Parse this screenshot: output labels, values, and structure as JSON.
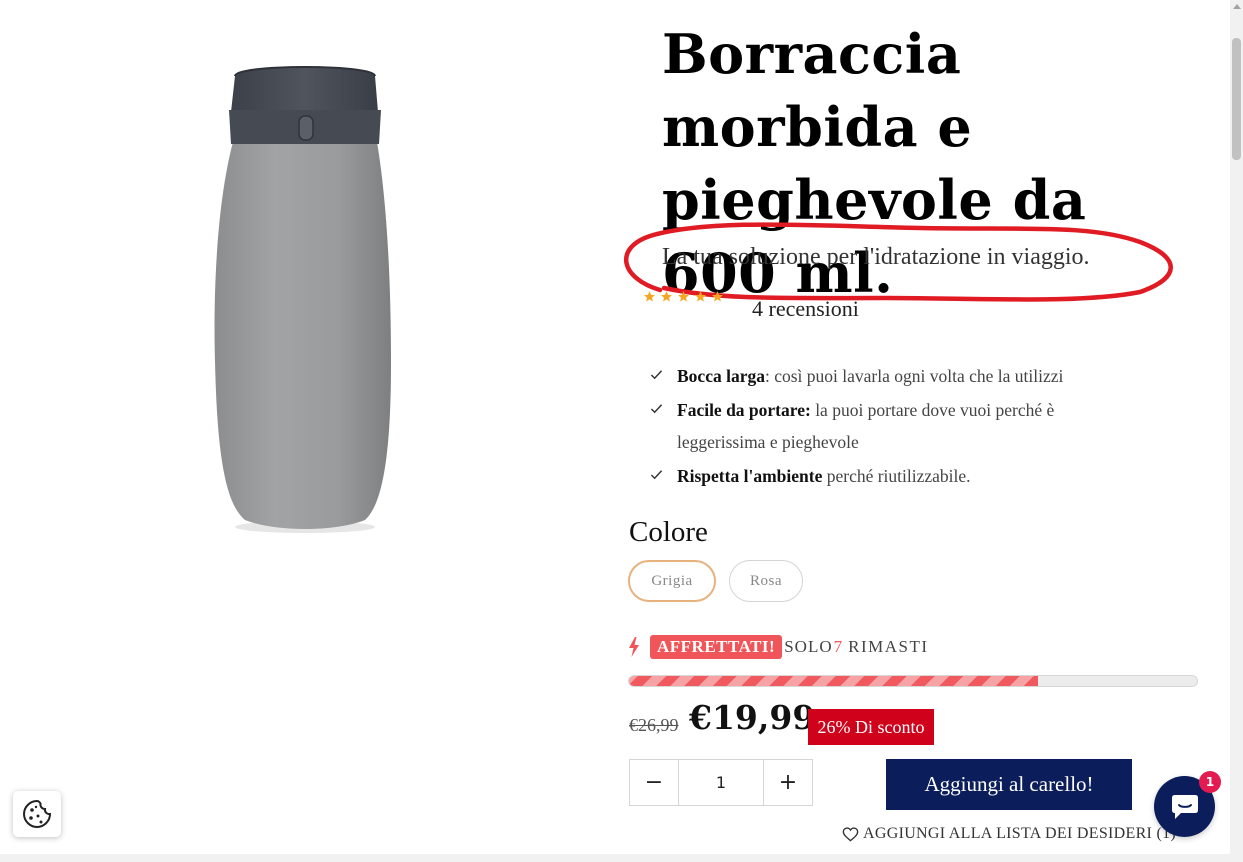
{
  "product": {
    "title": "Borraccia morbida e pieghevole da 600 ml.",
    "subtitle": "La tua soluzione per l'idratazione in viaggio.",
    "rating": 5,
    "reviews": "4 recensioni",
    "image_icon": "collapsible-bottle-image"
  },
  "features": [
    {
      "bold": "Bocca larga",
      "text": ": così puoi lavarla ogni volta che la utilizzi"
    },
    {
      "bold": "Facile da portare:",
      "text": " la puoi portare dove vuoi perché è leggerissima e pieghevole"
    },
    {
      "bold": "Rispetta l'ambiente",
      "text": " perché riutilizzabile."
    }
  ],
  "color": {
    "label": "Colore",
    "options": [
      "Grigia",
      "Rosa"
    ],
    "selected": "Grigia"
  },
  "stock": {
    "badge": "AFFRETTATI!",
    "only": "SOLO",
    "count": "7",
    "left": "RIMASTI",
    "progress_fraction": 0.72
  },
  "price": {
    "old": "€26,99",
    "current": "€19,99",
    "discount": "26% Di sconto"
  },
  "quantity": {
    "value": "1",
    "minus": "−",
    "plus": "+"
  },
  "cart": {
    "add_label": "Aggiungi al carello!",
    "wishlist": "AGGIUNGI ALLA LISTA DEI DESIDERI (1)"
  },
  "chat": {
    "badge": "1"
  },
  "colors": {
    "primary": "#0b1e5b",
    "urgent": "#f0555a",
    "discount": "#d0021b",
    "stars": "#f5a623",
    "annotation": "#e01b24"
  }
}
